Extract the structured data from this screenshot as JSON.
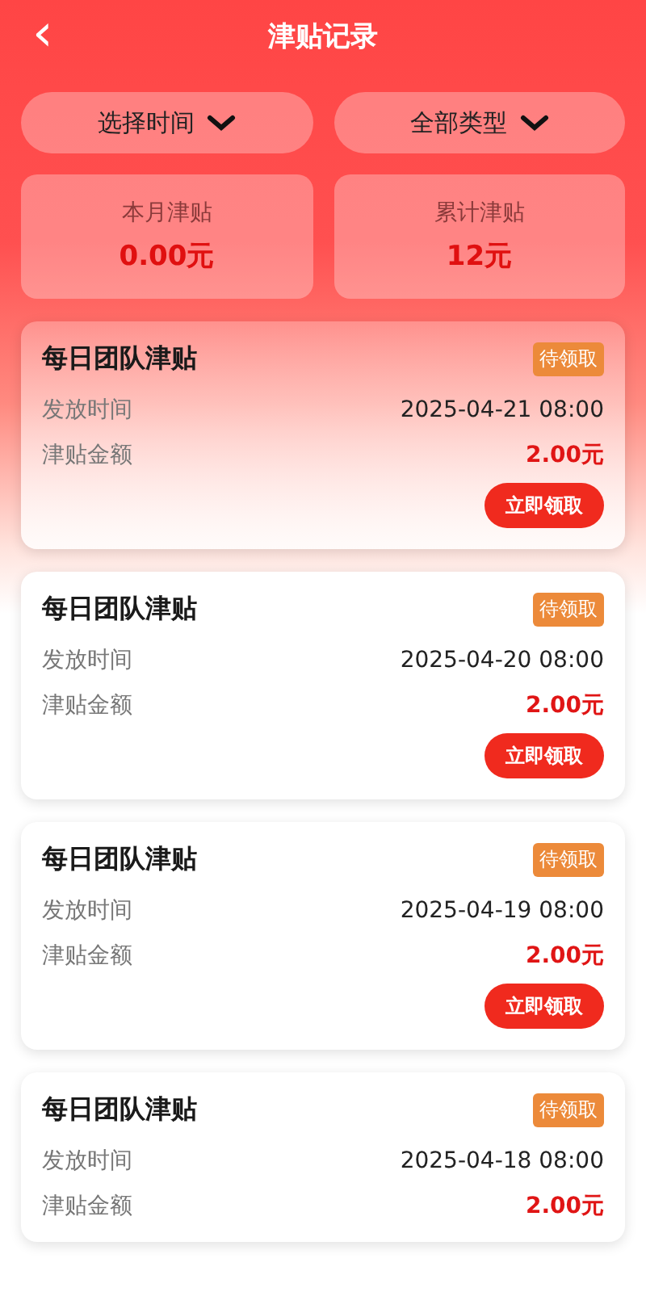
{
  "header": {
    "back_icon": "‹",
    "title": "津贴记录"
  },
  "filters": [
    {
      "label": "选择时间"
    },
    {
      "label": "全部类型"
    }
  ],
  "stats": [
    {
      "label": "本月津贴",
      "value": "0.00元"
    },
    {
      "label": "累计津贴",
      "value": "12元"
    }
  ],
  "records": [
    {
      "title": "每日团队津贴",
      "status": "待领取",
      "time_label": "发放时间",
      "time": "2025-04-21 08:00",
      "amount_label": "津贴金额",
      "amount": "2.00元",
      "button": "立即领取"
    },
    {
      "title": "每日团队津贴",
      "status": "待领取",
      "time_label": "发放时间",
      "time": "2025-04-20 08:00",
      "amount_label": "津贴金额",
      "amount": "2.00元",
      "button": "立即领取"
    },
    {
      "title": "每日团队津贴",
      "status": "待领取",
      "time_label": "发放时间",
      "time": "2025-04-19 08:00",
      "amount_label": "津贴金额",
      "amount": "2.00元",
      "button": "立即领取"
    },
    {
      "title": "每日团队津贴",
      "status": "待领取",
      "time_label": "发放时间",
      "time": "2025-04-18 08:00",
      "amount_label": "津贴金额",
      "amount": "2.00元"
    }
  ]
}
